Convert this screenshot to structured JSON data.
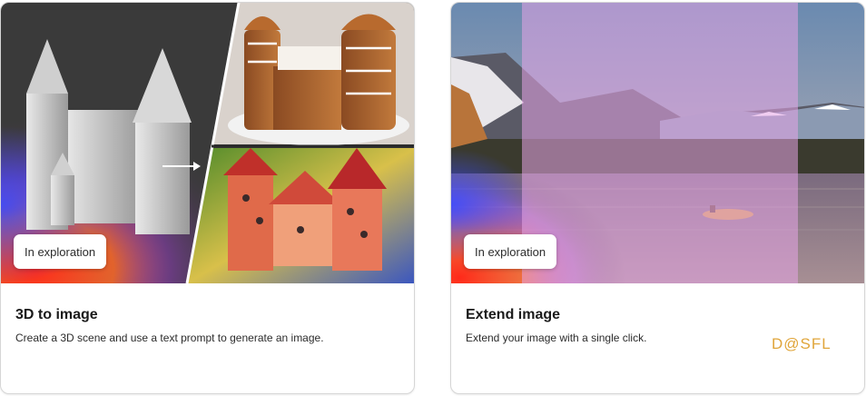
{
  "cards": [
    {
      "badge": "In exploration",
      "title": "3D to image",
      "description": "Create a 3D scene and use a text prompt to generate an image."
    },
    {
      "badge": "In exploration",
      "title": "Extend image",
      "description": "Extend your image with a single click."
    }
  ],
  "watermark": "D@SFL",
  "colors": {
    "watermark": "#e0a53a",
    "accent_glow_red": "#ff2a1a",
    "accent_glow_blue": "#3a4bff",
    "extend_overlay": "#e6a4e6"
  }
}
